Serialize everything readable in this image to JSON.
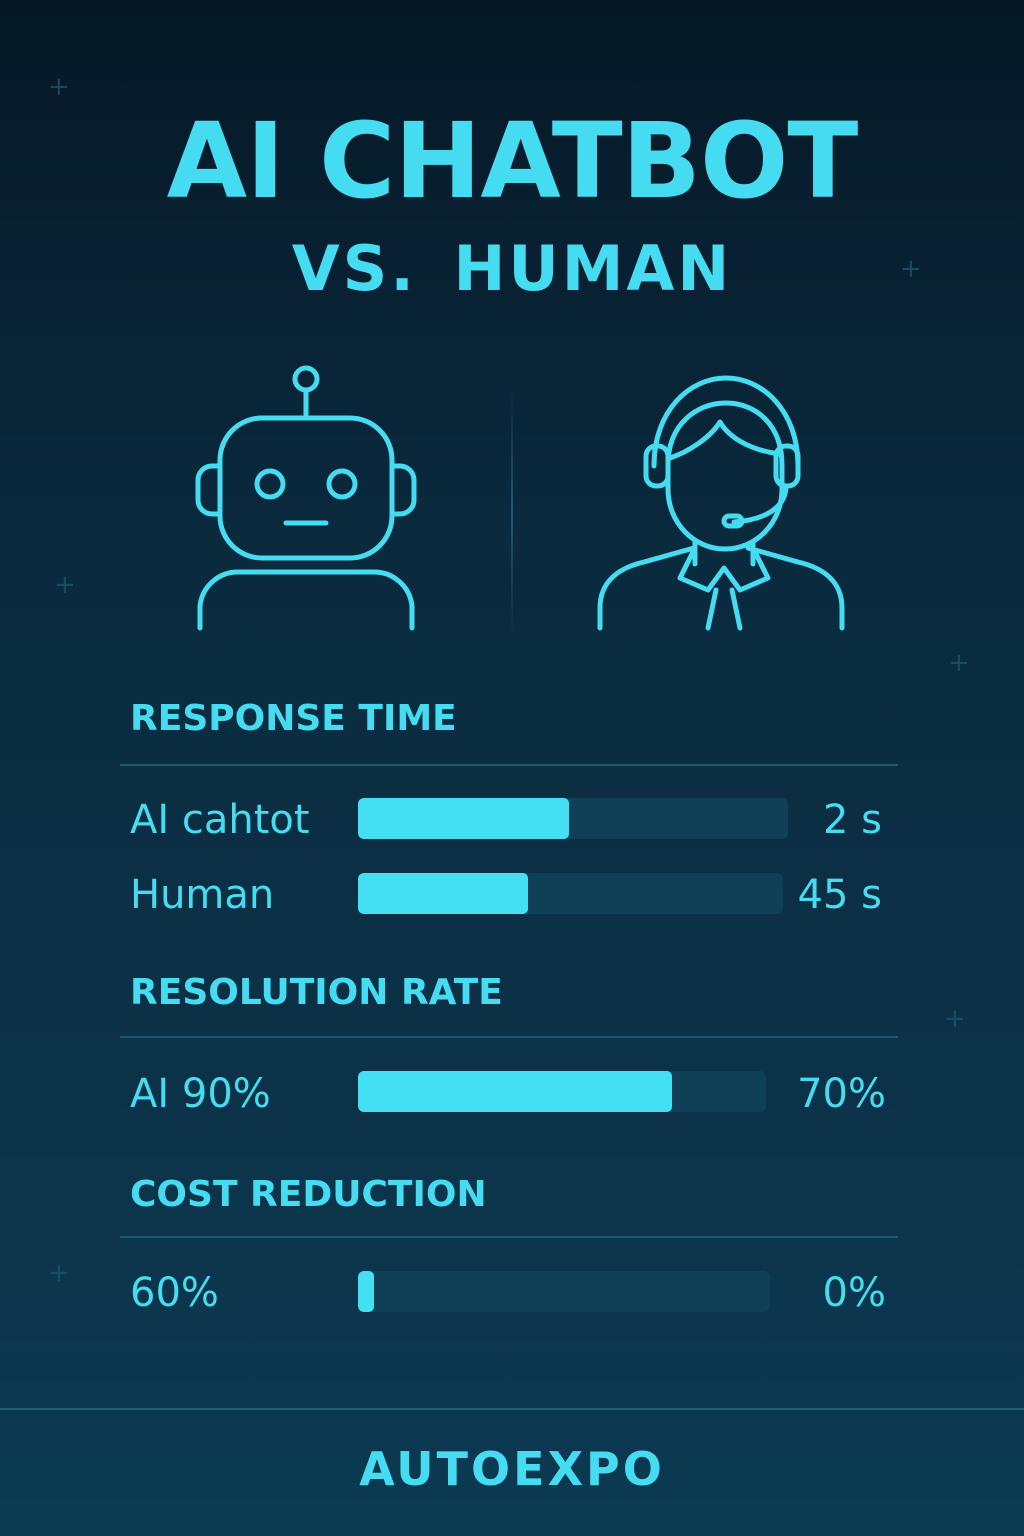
{
  "header": {
    "title": "AI CHATBOT",
    "subtitle": "VS. HUMAN"
  },
  "icons": {
    "left": "robot-icon",
    "right": "human-agent-headset-icon"
  },
  "colors": {
    "accent": "#45dcf2",
    "track": "#104057",
    "background_top": "#061826",
    "background_bottom": "#0b3a52"
  },
  "sections": {
    "response_time": {
      "title": "RESPONSE TIME",
      "rows": [
        {
          "label": "AI cahtot",
          "value": "2 s",
          "fill_fraction": 0.49
        },
        {
          "label": "Human",
          "value": "45 s",
          "fill_fraction": 0.4
        }
      ]
    },
    "resolution_rate": {
      "title": "RESOLUTION RATE",
      "rows": [
        {
          "label": "AI 90%",
          "value": "70%",
          "fill_fraction": 0.77
        }
      ]
    },
    "cost_reduction": {
      "title": "COST REDUCTION",
      "rows": [
        {
          "label": "60%",
          "value": "0%",
          "fill_fraction": 0.04
        }
      ]
    }
  },
  "footer": {
    "brand": "AUTOEXPO"
  }
}
